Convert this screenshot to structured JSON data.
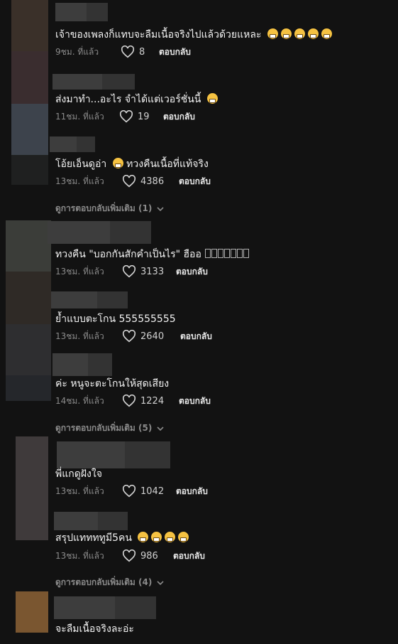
{
  "ui": {
    "reply_label": "ตอบกลับ",
    "view_more_template": "ดูการตอบกลับเพิ่มเติม"
  },
  "comments": [
    {
      "text": "เจ้าของเพลงก็แทบจะลืมเนื้อจริงไปแล้วด้วยแหละ",
      "time": "9ชม. ที่แล้ว",
      "likes": "8"
    },
    {
      "text": "ส่งมาทำ...อะไร จำได้แต่เวอร์ชั่นนี้",
      "time": "11ชม. ที่แล้ว",
      "likes": "19"
    },
    {
      "text": "โอ้ยเอ็นดูอ่า",
      "text_after": "ทวงคืนเนื้อที่แท้จริง",
      "time": "13ชม. ที่แล้ว",
      "likes": "4386",
      "more_replies": "ดูการตอบกลับเพิ่มเติม (1)"
    },
    {
      "text": "ทวงคืน \"บอกกันสักคำเป็นไร\" ฮืออ",
      "time": "13ชม. ที่แล้ว",
      "likes": "3133"
    },
    {
      "text": "ย้ำแบบตะโกน 555555555",
      "time": "13ชม. ที่แล้ว",
      "likes": "2640"
    },
    {
      "text": "ค่ะ หนูจะตะโกนให้สุดเสียง",
      "time": "14ชม. ที่แล้ว",
      "likes": "1224",
      "more_replies": "ดูการตอบกลับเพิ่มเติม (5)"
    },
    {
      "text": "พี่แกดูฝังใจ",
      "time": "13ชม. ที่แล้ว",
      "likes": "1042"
    },
    {
      "text": "สรุปแททททูมี5คน",
      "time": "13ชม. ที่แล้ว",
      "likes": "986",
      "more_replies": "ดูการตอบกลับเพิ่มเติม (4)"
    },
    {
      "text": "จะลืมเนื้อจริงละอ่ะ"
    }
  ],
  "colors": {
    "background": "#121212",
    "text": "#f2f2f2",
    "muted": "#8a8a8a"
  },
  "icons": {
    "like": "heart-icon",
    "expand": "chevron-down-icon",
    "emoji": "grinning-emoji"
  }
}
